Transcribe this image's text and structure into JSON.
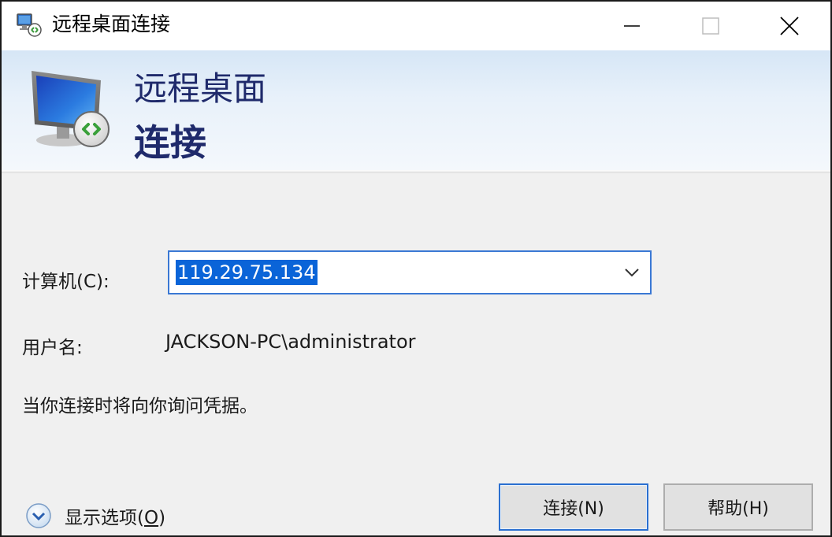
{
  "window": {
    "title": "远程桌面连接",
    "minimize_icon": "minimize-icon",
    "maximize_icon": "maximize-icon",
    "close_icon": "close-icon"
  },
  "banner": {
    "title_line1": "远程桌面",
    "title_line2": "连接",
    "icon": "remote-desktop-monitor-icon"
  },
  "form": {
    "computer_label": "计算机(C):",
    "computer_value": "119.29.75.134",
    "user_label": "用户名:",
    "user_value": "JACKSON-PC\\administrator",
    "notice": "当你连接时将向你询问凭据。"
  },
  "footer": {
    "options_label_prefix": "显示选项(",
    "options_label_mnemonic": "O",
    "options_label_suffix": ")",
    "connect_button": "连接(N)",
    "help_button": "帮助(H)"
  },
  "colors": {
    "banner_title": "#1f2a6b",
    "selection": "#0a64d8",
    "focus_border": "#3a78d4"
  }
}
